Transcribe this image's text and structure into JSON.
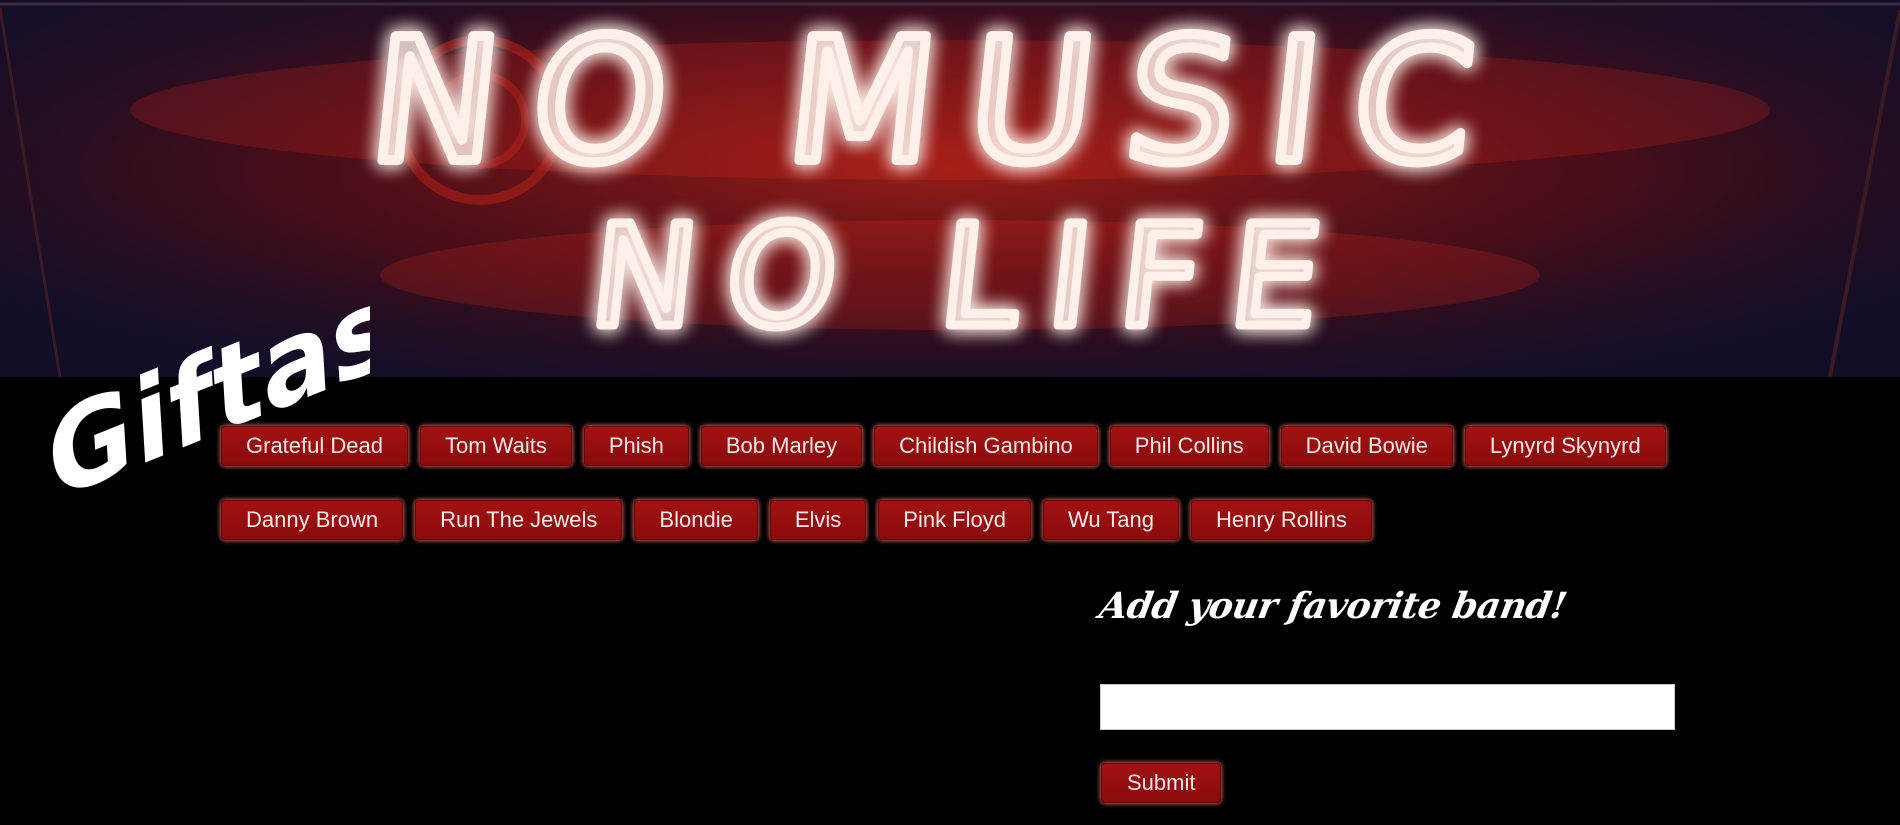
{
  "banner": {
    "line1": "NO MUSIC",
    "line2": "NO LIFE",
    "neon_color": "#fff1ea",
    "glow_color": "#ff3b22"
  },
  "logo": {
    "text": "Giftastic"
  },
  "bands": {
    "row1": [
      "Grateful Dead",
      "Tom Waits",
      "Phish",
      "Bob Marley",
      "Childish Gambino",
      "Phil Collins",
      "David Bowie",
      "Lynyrd Skynyrd"
    ],
    "row2": [
      "Danny Brown",
      "Run The Jewels",
      "Blondie",
      "Elvis",
      "Pink Floyd",
      "Wu Tang",
      "Henry Rollins"
    ]
  },
  "form": {
    "title": "Add your favorite band!",
    "input_value": "",
    "input_placeholder": "",
    "submit_label": "Submit"
  },
  "colors": {
    "background": "#000000",
    "button": "#9a1010",
    "button_text": "#f7e9e9"
  }
}
